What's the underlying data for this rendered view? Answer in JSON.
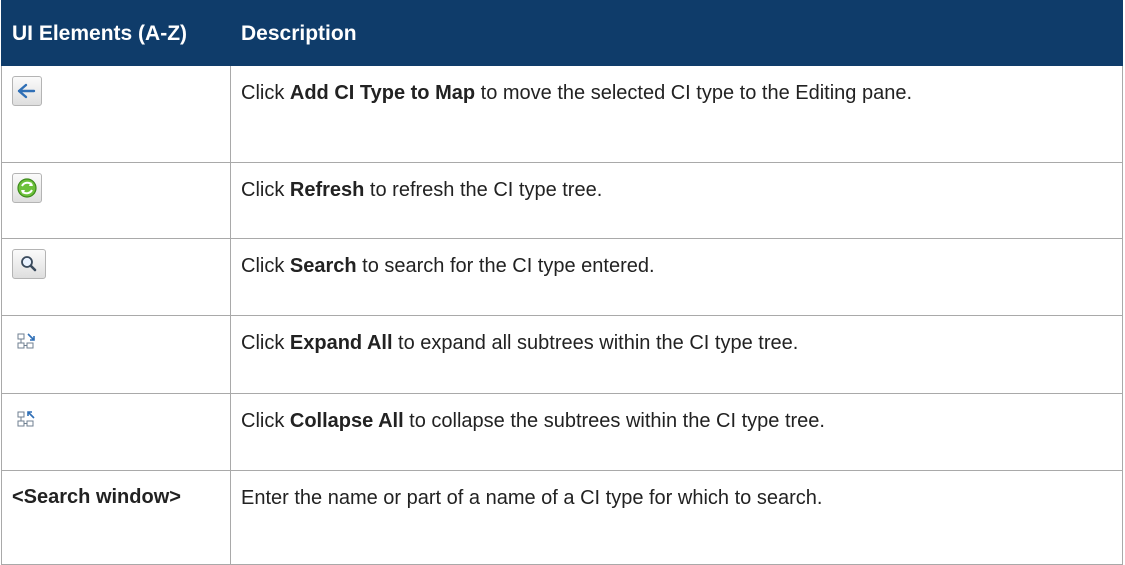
{
  "header": {
    "col1": "UI Elements (A-Z)",
    "col2": "Description"
  },
  "rows": [
    {
      "icon": "add-ci-type-arrow-icon",
      "pre": "Click ",
      "bold": "Add CI Type to Map",
      "post": " to move the selected CI type to the Editing pane."
    },
    {
      "icon": "refresh-icon",
      "pre": "Click ",
      "bold": "Refresh",
      "post": " to refresh the CI type tree."
    },
    {
      "icon": "search-icon",
      "pre": "Click ",
      "bold": "Search",
      "post": " to search for the CI type entered."
    },
    {
      "icon": "expand-all-icon",
      "pre": "Click ",
      "bold": "Expand All",
      "post": " to expand all subtrees within the CI type tree."
    },
    {
      "icon": "collapse-all-icon",
      "pre": "Click ",
      "bold": "Collapse All",
      "post": " to collapse the subtrees within the CI type tree."
    },
    {
      "label": "<Search window>",
      "text": "Enter the name or part of a name of a CI type for which to search."
    }
  ],
  "colors": {
    "header_bg": "#0f3c6a",
    "header_text": "#ffffff",
    "border": "#a9a9a9"
  }
}
